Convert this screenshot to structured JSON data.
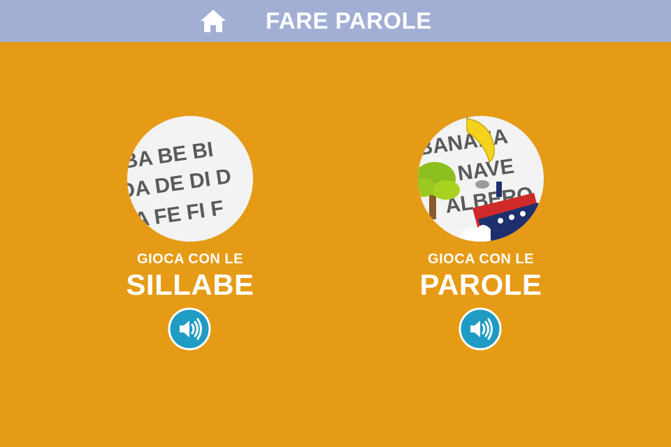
{
  "header": {
    "title": "FARE PAROLE",
    "home_icon": "home-icon",
    "background": "#a2aed4"
  },
  "background_color": "#e69b16",
  "cards": [
    {
      "kicker": "GIOCA CON LE",
      "title": "SILLABE",
      "thumbnail_text": [
        "BA BE BI",
        "DA DE DI D",
        "FA FE FI F"
      ],
      "audio_icon": "speaker-icon"
    },
    {
      "kicker": "GIOCA CON LE",
      "title": "PAROLE",
      "thumbnail_text": [
        "BANANA",
        "NAVE",
        "ALBERO"
      ],
      "audio_icon": "speaker-icon"
    }
  ],
  "colors": {
    "speaker_button": "#1f9bc4",
    "speaker_border": "#ffffff"
  }
}
